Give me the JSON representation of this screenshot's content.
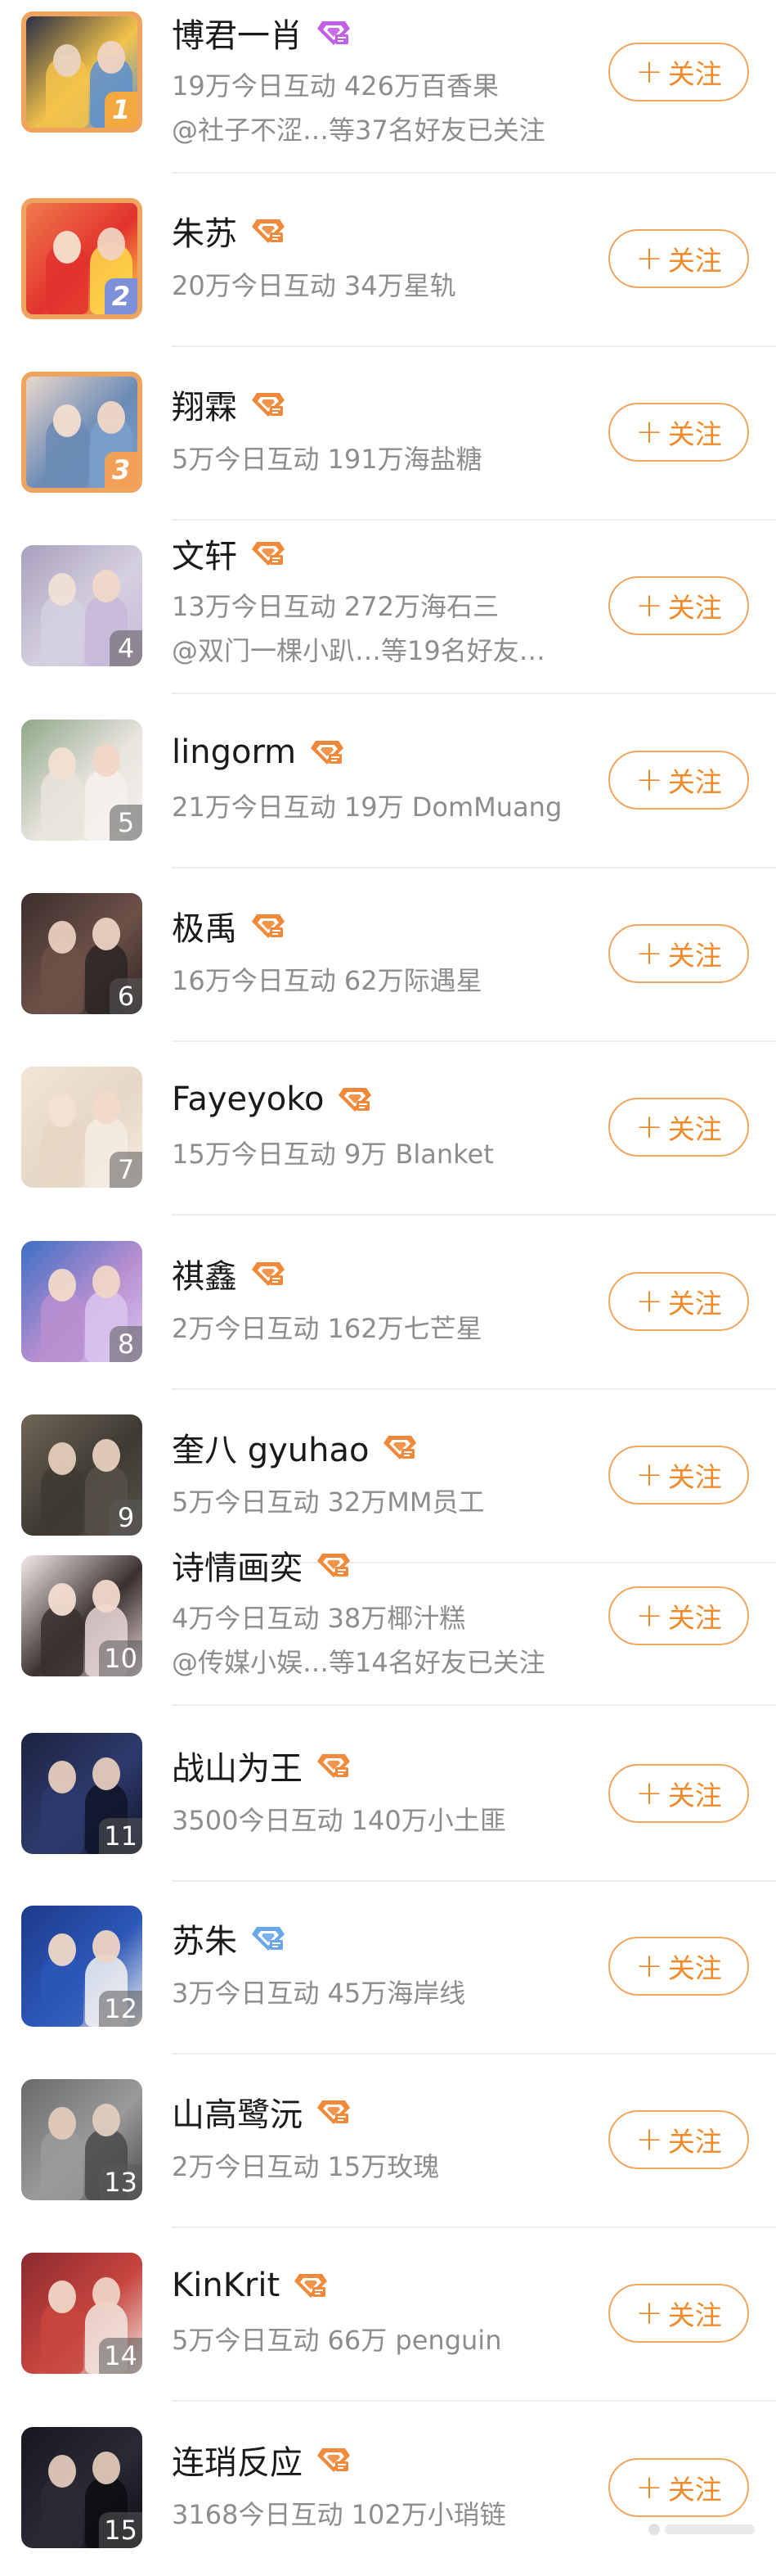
{
  "follow_label": "关注",
  "colors": {
    "accent": "#f08a2a",
    "follow_border": "#f0a660",
    "name_text": "#1a1a1a",
    "meta_text": "#8d8d8d",
    "badge_gold": "#f08a3a",
    "badge_purple": "#c35ee6",
    "badge_blue": "#6aa6e8"
  },
  "rows": [
    {
      "rank": "1",
      "name": "博君一肖",
      "badge": "purple-diamond-icon",
      "stats": "19万今日互动 426万百香果",
      "friends": "@社子不涩…等37名好友已关注"
    },
    {
      "rank": "2",
      "name": "朱苏",
      "badge": "gold-diamond-icon",
      "stats": "20万今日互动 34万星轨",
      "friends": ""
    },
    {
      "rank": "3",
      "name": "翔霖",
      "badge": "gold-diamond-icon",
      "stats": "5万今日互动 191万海盐糖",
      "friends": ""
    },
    {
      "rank": "4",
      "name": "文轩",
      "badge": "gold-diamond-icon",
      "stats": "13万今日互动 272万海石三",
      "friends": "@双门一棵小趴…等19名好友…"
    },
    {
      "rank": "5",
      "name": "lingorm",
      "badge": "gold-diamond-icon",
      "stats": "21万今日互动 19万 DomMuang",
      "friends": ""
    },
    {
      "rank": "6",
      "name": "极禹",
      "badge": "gold-diamond-icon",
      "stats": "16万今日互动 62万际遇星",
      "friends": ""
    },
    {
      "rank": "7",
      "name": "Fayeyoko",
      "badge": "gold-diamond-icon",
      "stats": "15万今日互动 9万 Blanket",
      "friends": ""
    },
    {
      "rank": "8",
      "name": "祺鑫",
      "badge": "gold-diamond-icon",
      "stats": "2万今日互动 162万七芒星",
      "friends": ""
    },
    {
      "rank": "9",
      "name": "奎八 gyuhao",
      "badge": "gold-diamond-icon",
      "stats": "5万今日互动 32万MM员工",
      "friends": ""
    },
    {
      "rank": "10",
      "name": "诗情画奕",
      "badge": "gold-diamond-icon",
      "stats": "4万今日互动 38万椰汁糕",
      "friends": "@传媒小娱…等14名好友已关注"
    },
    {
      "rank": "11",
      "name": "战山为王",
      "badge": "gold-diamond-icon",
      "stats": "3500今日互动 140万小土匪",
      "friends": ""
    },
    {
      "rank": "12",
      "name": "苏朱",
      "badge": "blue-diamond-icon",
      "stats": "3万今日互动 45万海岸线",
      "friends": ""
    },
    {
      "rank": "13",
      "name": "山高鹭沅",
      "badge": "gold-diamond-icon",
      "stats": "2万今日互动 15万玫瑰",
      "friends": ""
    },
    {
      "rank": "14",
      "name": "KinKrit",
      "badge": "gold-diamond-icon",
      "stats": "5万今日互动 66万 penguin",
      "friends": ""
    },
    {
      "rank": "15",
      "name": "连琑反应",
      "badge": "gold-diamond-icon",
      "stats": "3168今日互动 102万小琑链",
      "friends": ""
    }
  ]
}
